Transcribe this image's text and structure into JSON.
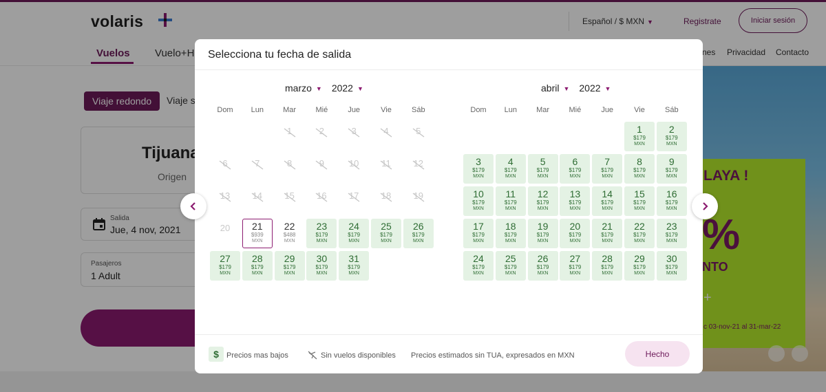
{
  "header": {
    "brand": "volaris",
    "language_currency": "Español / $ MXN",
    "register_label": "Registrate",
    "login_label": "Iniciar sesión"
  },
  "nav": {
    "items": [
      "Vuelos",
      "Vuelo+H"
    ],
    "right_items": [
      "nes",
      "Privacidad",
      "Contacto"
    ]
  },
  "booking": {
    "trip_types": [
      "Viaje redondo",
      "Viaje se"
    ],
    "origin_city": "Tijuana",
    "origin_label": "Origen",
    "departure_label": "Salida",
    "departure_value": "Jue, 4 nov, 2021",
    "passengers_label": "Pasajeros",
    "passengers_value": "1 Adult"
  },
  "promo": {
    "headline": "LAYA !",
    "percent": "%",
    "sub": "NTO",
    "plus": "+",
    "dates": "c 03-nov-21 al 31-mar-22"
  },
  "modal": {
    "title": "Selecciona tu fecha de salida",
    "weekdays": [
      "Dom",
      "Lun",
      "Mar",
      "Mié",
      "Jue",
      "Vie",
      "Sáb"
    ],
    "months": [
      {
        "month": "marzo",
        "year": "2022",
        "days": [
          {
            "d": "1",
            "type": "past",
            "col": 2,
            "row": 0
          },
          {
            "d": "2",
            "type": "past",
            "col": 3,
            "row": 0
          },
          {
            "d": "3",
            "type": "past",
            "col": 4,
            "row": 0
          },
          {
            "d": "4",
            "type": "past",
            "col": 5,
            "row": 0
          },
          {
            "d": "5",
            "type": "past",
            "col": 6,
            "row": 0
          },
          {
            "d": "6",
            "type": "past",
            "col": 0,
            "row": 1
          },
          {
            "d": "7",
            "type": "past",
            "col": 1,
            "row": 1
          },
          {
            "d": "8",
            "type": "past",
            "col": 2,
            "row": 1
          },
          {
            "d": "9",
            "type": "past",
            "col": 3,
            "row": 1
          },
          {
            "d": "10",
            "type": "past",
            "col": 4,
            "row": 1
          },
          {
            "d": "11",
            "type": "past",
            "col": 5,
            "row": 1
          },
          {
            "d": "12",
            "type": "past",
            "col": 6,
            "row": 1
          },
          {
            "d": "13",
            "type": "past",
            "col": 0,
            "row": 2
          },
          {
            "d": "14",
            "type": "past",
            "col": 1,
            "row": 2
          },
          {
            "d": "15",
            "type": "past",
            "col": 2,
            "row": 2
          },
          {
            "d": "16",
            "type": "past",
            "col": 3,
            "row": 2
          },
          {
            "d": "17",
            "type": "past",
            "col": 4,
            "row": 2
          },
          {
            "d": "18",
            "type": "past",
            "col": 5,
            "row": 2
          },
          {
            "d": "19",
            "type": "past",
            "col": 6,
            "row": 2
          },
          {
            "d": "20",
            "type": "unavailable",
            "col": 0,
            "row": 3
          },
          {
            "d": "21",
            "type": "selected",
            "price": "$939",
            "cur": "MXN",
            "col": 1,
            "row": 3
          },
          {
            "d": "22",
            "type": "normal",
            "price": "$488",
            "cur": "MXN",
            "col": 2,
            "row": 3
          },
          {
            "d": "23",
            "type": "low",
            "price": "$179",
            "cur": "MXN",
            "col": 3,
            "row": 3
          },
          {
            "d": "24",
            "type": "low",
            "price": "$179",
            "cur": "MXN",
            "col": 4,
            "row": 3
          },
          {
            "d": "25",
            "type": "low",
            "price": "$179",
            "cur": "MXN",
            "col": 5,
            "row": 3
          },
          {
            "d": "26",
            "type": "low",
            "price": "$179",
            "cur": "MXN",
            "col": 6,
            "row": 3
          },
          {
            "d": "27",
            "type": "low",
            "price": "$179",
            "cur": "MXN",
            "col": 0,
            "row": 4
          },
          {
            "d": "28",
            "type": "low",
            "price": "$179",
            "cur": "MXN",
            "col": 1,
            "row": 4
          },
          {
            "d": "29",
            "type": "low",
            "price": "$179",
            "cur": "MXN",
            "col": 2,
            "row": 4
          },
          {
            "d": "30",
            "type": "low",
            "price": "$179",
            "cur": "MXN",
            "col": 3,
            "row": 4
          },
          {
            "d": "31",
            "type": "low",
            "price": "$179",
            "cur": "MXN",
            "col": 4,
            "row": 4
          }
        ]
      },
      {
        "month": "abril",
        "year": "2022",
        "days": [
          {
            "d": "1",
            "type": "low",
            "price": "$179",
            "cur": "MXN",
            "col": 5,
            "row": 0
          },
          {
            "d": "2",
            "type": "low",
            "price": "$179",
            "cur": "MXN",
            "col": 6,
            "row": 0
          },
          {
            "d": "3",
            "type": "low",
            "price": "$179",
            "cur": "MXN",
            "col": 0,
            "row": 1
          },
          {
            "d": "4",
            "type": "low",
            "price": "$179",
            "cur": "MXN",
            "col": 1,
            "row": 1
          },
          {
            "d": "5",
            "type": "low",
            "price": "$179",
            "cur": "MXN",
            "col": 2,
            "row": 1
          },
          {
            "d": "6",
            "type": "low",
            "price": "$179",
            "cur": "MXN",
            "col": 3,
            "row": 1
          },
          {
            "d": "7",
            "type": "low",
            "price": "$179",
            "cur": "MXN",
            "col": 4,
            "row": 1
          },
          {
            "d": "8",
            "type": "low",
            "price": "$179",
            "cur": "MXN",
            "col": 5,
            "row": 1
          },
          {
            "d": "9",
            "type": "low",
            "price": "$179",
            "cur": "MXN",
            "col": 6,
            "row": 1
          },
          {
            "d": "10",
            "type": "low",
            "price": "$179",
            "cur": "MXN",
            "col": 0,
            "row": 2
          },
          {
            "d": "11",
            "type": "low",
            "price": "$179",
            "cur": "MXN",
            "col": 1,
            "row": 2
          },
          {
            "d": "12",
            "type": "low",
            "price": "$179",
            "cur": "MXN",
            "col": 2,
            "row": 2
          },
          {
            "d": "13",
            "type": "low",
            "price": "$179",
            "cur": "MXN",
            "col": 3,
            "row": 2
          },
          {
            "d": "14",
            "type": "low",
            "price": "$179",
            "cur": "MXN",
            "col": 4,
            "row": 2
          },
          {
            "d": "15",
            "type": "low",
            "price": "$179",
            "cur": "MXN",
            "col": 5,
            "row": 2
          },
          {
            "d": "16",
            "type": "low",
            "price": "$179",
            "cur": "MXN",
            "col": 6,
            "row": 2
          },
          {
            "d": "17",
            "type": "low",
            "price": "$179",
            "cur": "MXN",
            "col": 0,
            "row": 3
          },
          {
            "d": "18",
            "type": "low",
            "price": "$179",
            "cur": "MXN",
            "col": 1,
            "row": 3
          },
          {
            "d": "19",
            "type": "low",
            "price": "$179",
            "cur": "MXN",
            "col": 2,
            "row": 3
          },
          {
            "d": "20",
            "type": "low",
            "price": "$179",
            "cur": "MXN",
            "col": 3,
            "row": 3
          },
          {
            "d": "21",
            "type": "low",
            "price": "$179",
            "cur": "MXN",
            "col": 4,
            "row": 3
          },
          {
            "d": "22",
            "type": "low",
            "price": "$179",
            "cur": "MXN",
            "col": 5,
            "row": 3
          },
          {
            "d": "23",
            "type": "low",
            "price": "$179",
            "cur": "MXN",
            "col": 6,
            "row": 3
          },
          {
            "d": "24",
            "type": "low",
            "price": "$179",
            "cur": "MXN",
            "col": 0,
            "row": 4
          },
          {
            "d": "25",
            "type": "low",
            "price": "$179",
            "cur": "MXN",
            "col": 1,
            "row": 4
          },
          {
            "d": "26",
            "type": "low",
            "price": "$179",
            "cur": "MXN",
            "col": 2,
            "row": 4
          },
          {
            "d": "27",
            "type": "low",
            "price": "$179",
            "cur": "MXN",
            "col": 3,
            "row": 4
          },
          {
            "d": "28",
            "type": "low",
            "price": "$179",
            "cur": "MXN",
            "col": 4,
            "row": 4
          },
          {
            "d": "29",
            "type": "low",
            "price": "$179",
            "cur": "MXN",
            "col": 5,
            "row": 4
          },
          {
            "d": "30",
            "type": "low",
            "price": "$179",
            "cur": "MXN",
            "col": 6,
            "row": 4
          }
        ]
      }
    ],
    "legend": {
      "low_icon": "$",
      "low_label": "Precios mas bajos",
      "none_label": "Sin vuelos disponibles",
      "note": "Precios estimados sin TUA, expresados en MXN"
    },
    "done_label": "Hecho"
  },
  "colors": {
    "brand": "#6d1a5a",
    "accent": "#8c1b70",
    "low_price_bg": "#e4f2e4",
    "low_price_text": "#2e6c33"
  },
  "icons": [
    "logo-plus-icon",
    "calendar-icon",
    "chevron-left-icon",
    "chevron-right-icon",
    "dollar-icon",
    "no-flight-icon",
    "caret-down-icon"
  ]
}
